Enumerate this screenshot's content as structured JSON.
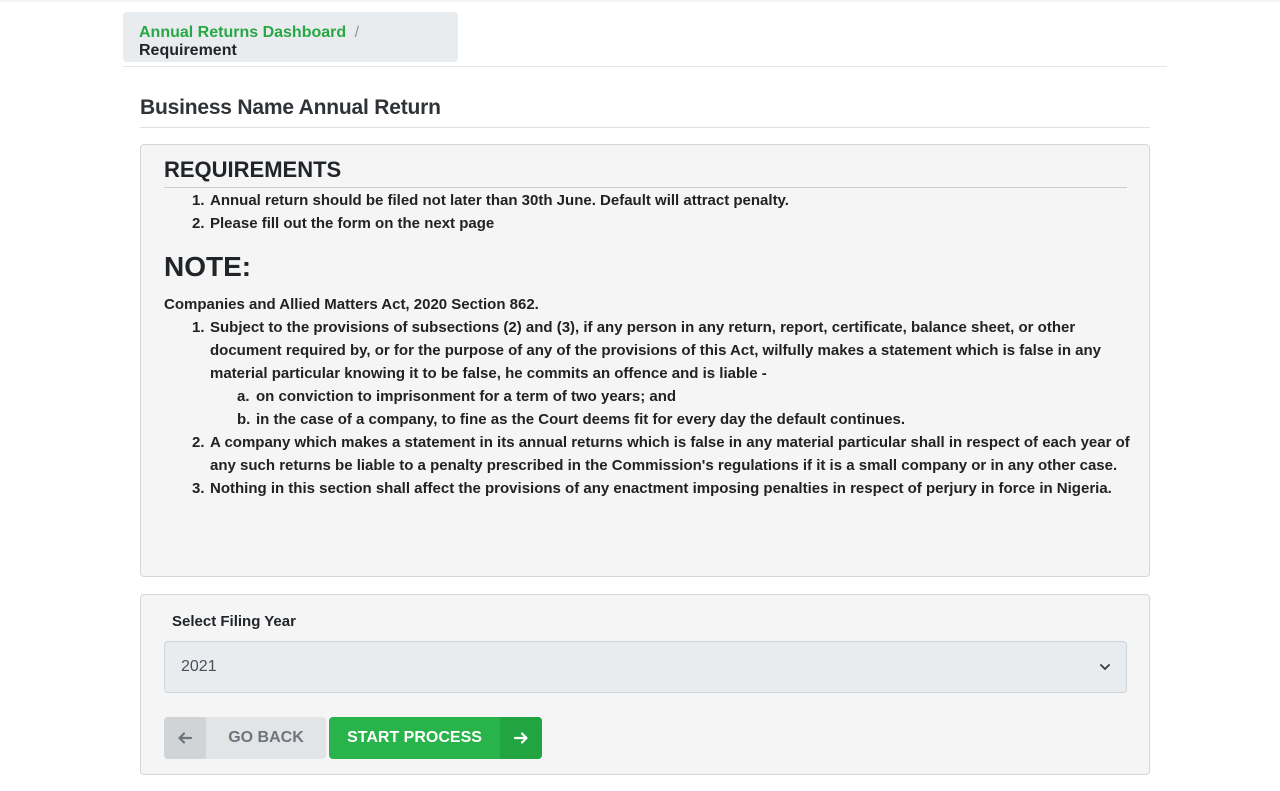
{
  "breadcrumb": {
    "link": "Annual Returns Dashboard",
    "separator": "/",
    "current": "Requirement"
  },
  "page_title": "Business Name Annual Return",
  "requirements": {
    "heading": "REQUIREMENTS",
    "items": [
      {
        "num": "1.",
        "text": "Annual return should be filed not later than 30th June. Default will attract penalty."
      },
      {
        "num": "2.",
        "text": "Please fill out the form on the next page"
      }
    ]
  },
  "note": {
    "heading": "NOTE:",
    "act_title": "Companies and Allied Matters Act, 2020 Section 862.",
    "items": [
      {
        "num": "1.",
        "text": "Subject to the provisions of subsections (2) and (3), if any person in any return, report, certificate, balance sheet, or other document required by, or for the purpose of any of the provisions of this Act, wilfully makes a statement which is false in any material particular knowing it to be false, he commits an offence and is liable -"
      },
      {
        "num": "a.",
        "text": "on conviction to imprisonment for a term of two years; and"
      },
      {
        "num": "b.",
        "text": "in the case of a company, to fine as the Court deems fit for every day the default continues."
      },
      {
        "num": "2.",
        "text": "A company which makes a statement in its annual returns which is false in any material particular shall in respect of each year of any such returns be liable to a penalty prescribed in the Commission's regulations if it is a small company or in any other case."
      },
      {
        "num": "3.",
        "text": "Nothing in this section shall affect the provisions of any enactment imposing penalties in respect of perjury in force in Nigeria."
      }
    ]
  },
  "form": {
    "label": "Select Filing Year",
    "selected_year": "2021",
    "back_label": "GO BACK",
    "start_label": "START PROCESS"
  },
  "colors": {
    "accent_green": "#28b44a",
    "link_green": "#28a745",
    "card_bg": "#f5f5f5"
  },
  "icons": [
    "arrow-left-icon",
    "arrow-right-icon",
    "chevron-down-icon"
  ]
}
